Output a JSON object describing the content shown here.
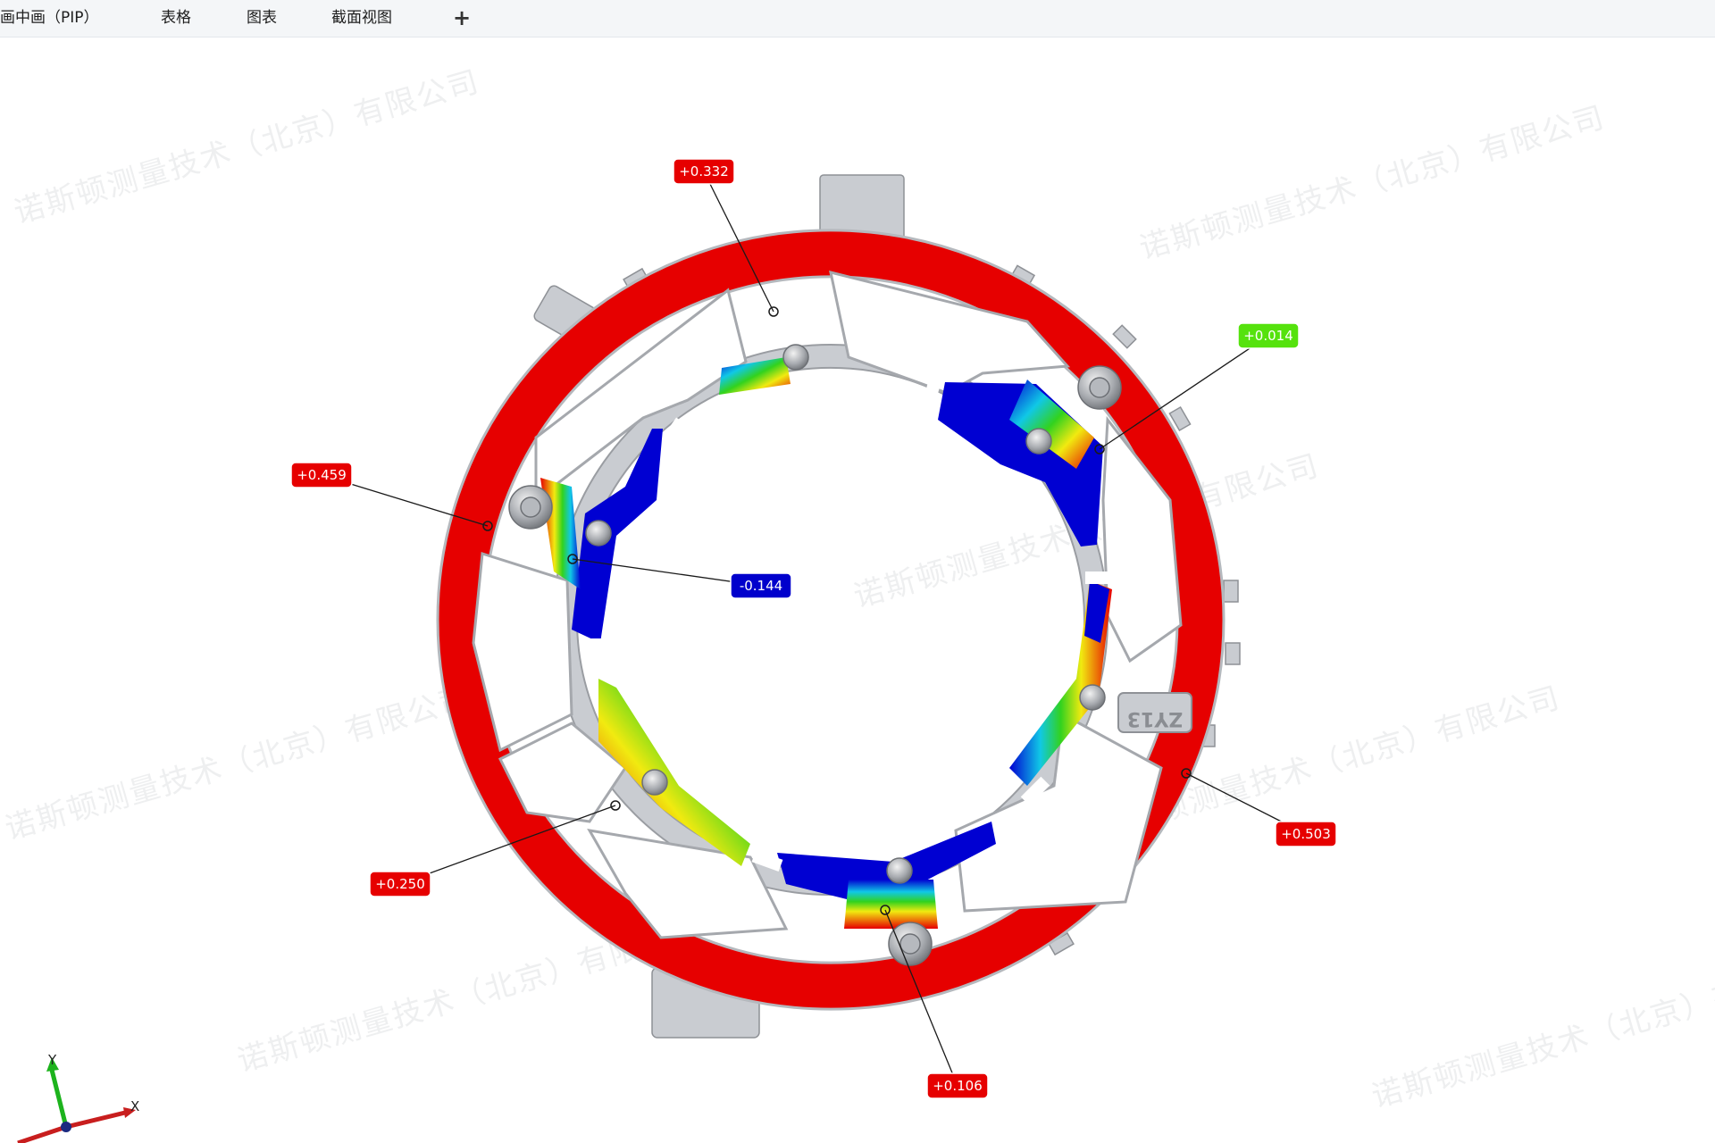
{
  "tabs": [
    {
      "label": "画中画（PIP）"
    },
    {
      "label": "表格"
    },
    {
      "label": "图表"
    },
    {
      "label": "截面视图"
    }
  ],
  "add_tab_label": "+",
  "watermark": "诺斯顿测量技术（北京）有限公司",
  "part_marking": "ZY13",
  "annotations": [
    {
      "value": "+0.332",
      "color": "#e60000"
    },
    {
      "value": "+0.014",
      "color": "#55e20d"
    },
    {
      "value": "+0.459",
      "color": "#e60000"
    },
    {
      "value": "-0.144",
      "color": "#0000cc"
    },
    {
      "value": "+0.503",
      "color": "#e60000"
    },
    {
      "value": "+0.250",
      "color": "#e60000"
    },
    {
      "value": "+0.106",
      "color": "#e60000"
    }
  ],
  "axis": {
    "y_label": "Y",
    "x_label": "X"
  },
  "colors": {
    "deviation_high": "#e60000",
    "deviation_low": "#0000d2",
    "deviation_zero": "#55e20d",
    "part_gray": "#c9ccd1",
    "tab_bar": "#f4f6f8"
  }
}
